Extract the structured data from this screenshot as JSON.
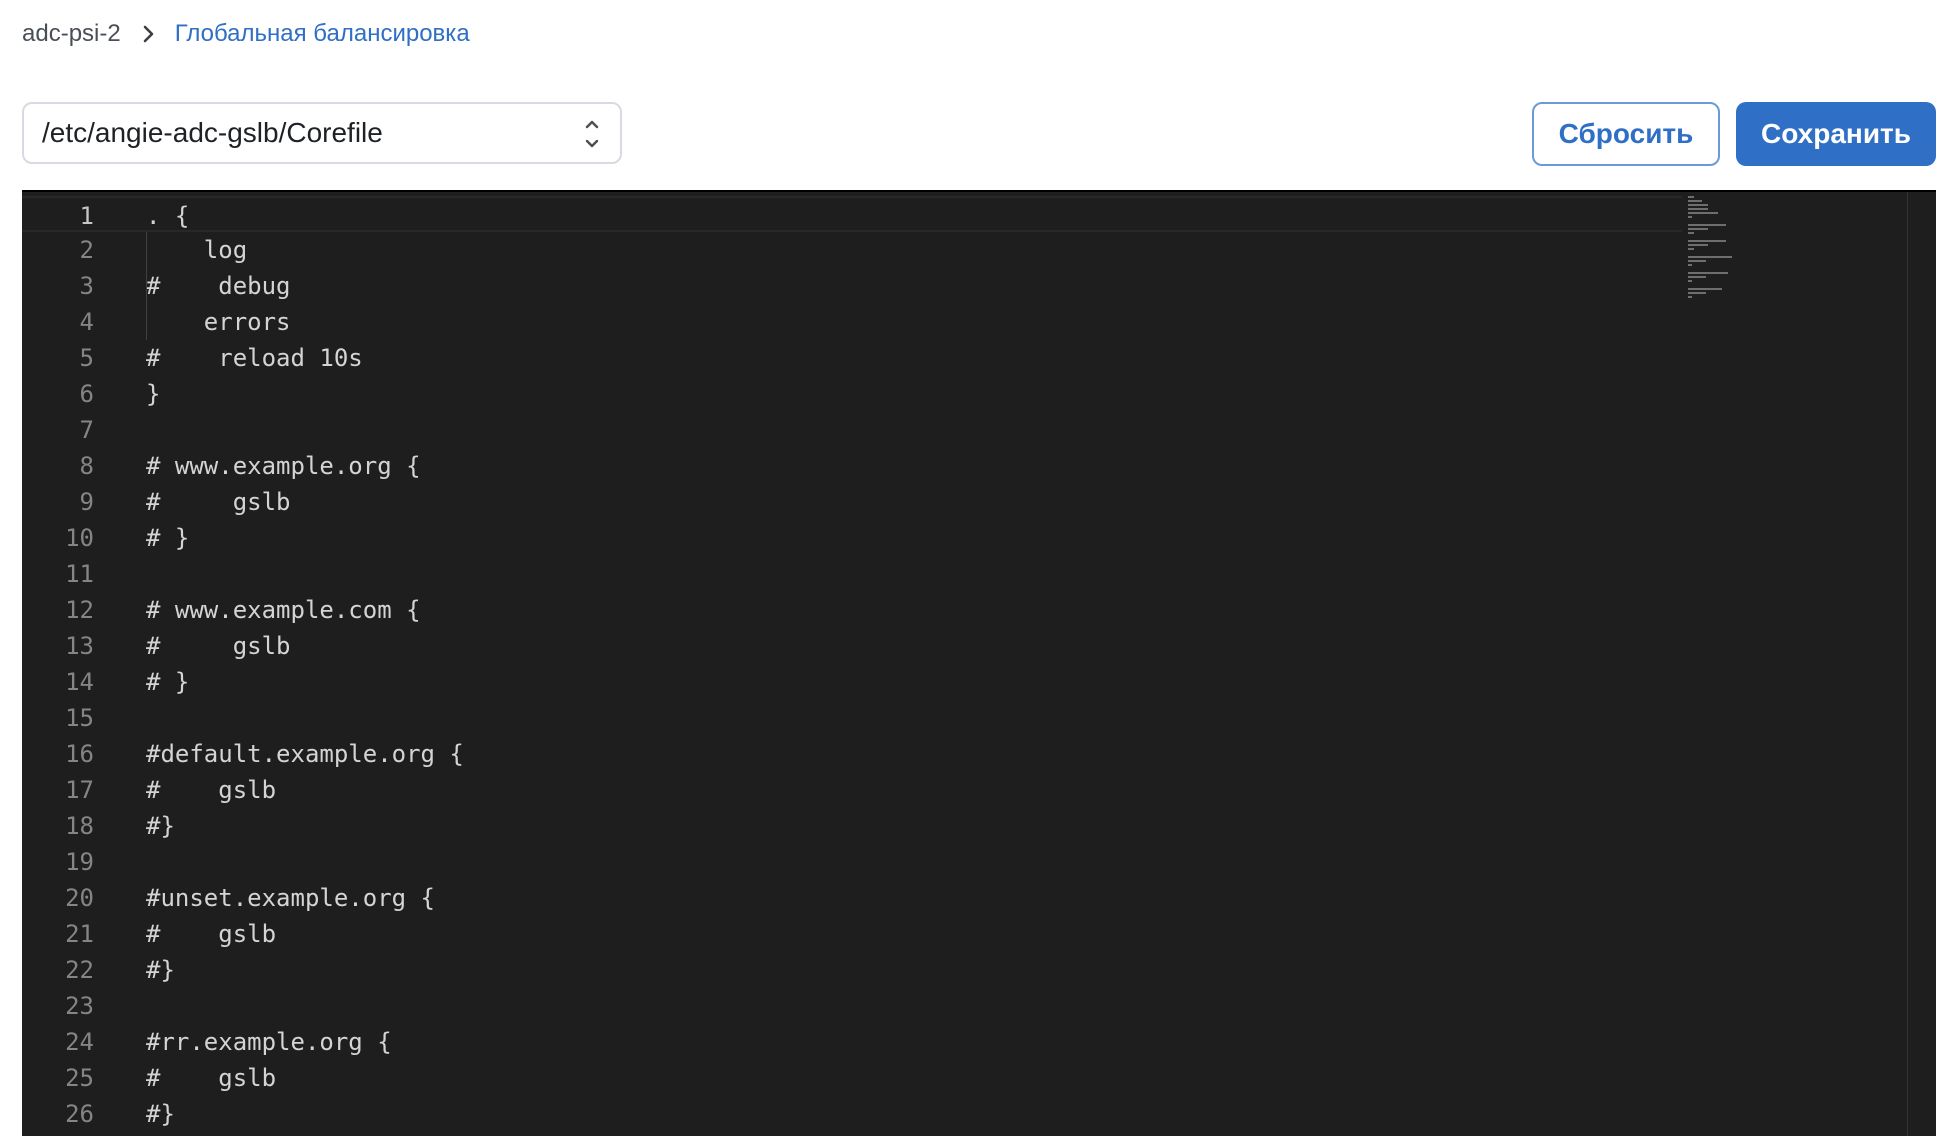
{
  "breadcrumb": {
    "root": "adc-psi-2",
    "current": "Глобальная балансировка"
  },
  "file_select": {
    "value": "/etc/angie-adc-gslb/Corefile"
  },
  "buttons": {
    "reset": "Сбросить",
    "save": "Сохранить"
  },
  "editor": {
    "active_line": 1,
    "lines": [
      ". {",
      "    log",
      "#    debug",
      "    errors",
      "#    reload 10s",
      "}",
      "",
      "# www.example.org {",
      "#     gslb",
      "# }",
      "",
      "# www.example.com {",
      "#     gslb",
      "# }",
      "",
      "#default.example.org {",
      "#    gslb",
      "#}",
      "",
      "#unset.example.org {",
      "#    gslb",
      "#}",
      "",
      "#rr.example.org {",
      "#    gslb",
      "#}"
    ]
  }
}
